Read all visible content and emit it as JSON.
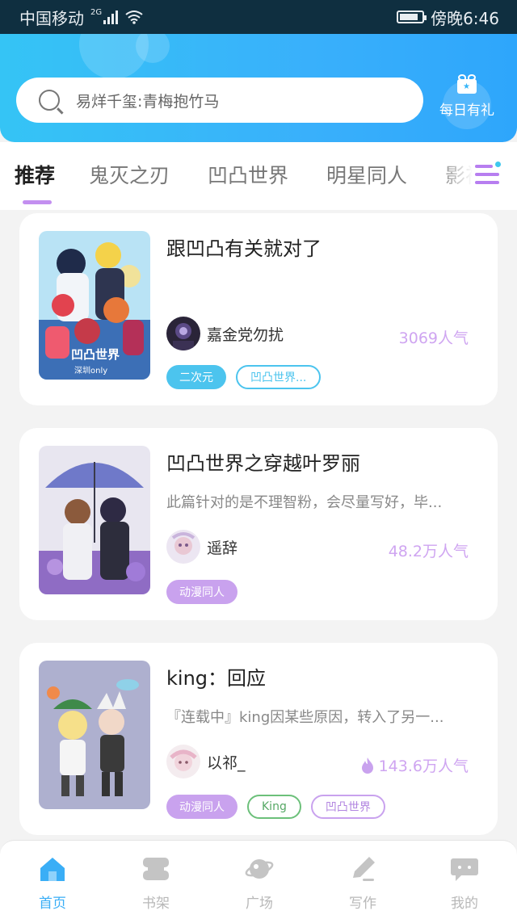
{
  "status_bar": {
    "carrier": "中国移动",
    "network": "2G",
    "time": "傍晚6:46"
  },
  "header": {
    "search_text": "易烊千玺:青梅抱竹马",
    "gift_label": "每日有礼"
  },
  "tabs": [
    "推荐",
    "鬼灭之刃",
    "凹凸世界",
    "明星同人",
    "影视"
  ],
  "cards": [
    {
      "title": "跟凹凸有关就对了",
      "author": "嘉金党勿扰",
      "popularity": "3069人气",
      "tags": [
        "二次元",
        "凹凸世界..."
      ],
      "cover_text": "凹凸世界\n深圳only"
    },
    {
      "title": "凹凸世界之穿越叶罗丽",
      "description": "此篇针对的是不理智粉，会尽量写好，毕...",
      "author": "遥辞",
      "popularity": "48.2万人气",
      "tags": [
        "动漫同人"
      ]
    },
    {
      "title": "king：回应",
      "description": "『连载中』king因某些原因，转入了另一...",
      "author": "以祁_",
      "popularity": "143.6万人气",
      "tags": [
        "动漫同人",
        "King",
        "凹凸世界"
      ]
    }
  ],
  "bottom_nav": [
    "首页",
    "书架",
    "广场",
    "写作",
    "我的"
  ],
  "colors": {
    "accent_blue": "#3aaef6",
    "accent_purple": "#c38ff0",
    "popularity": "#cfa5f1"
  }
}
